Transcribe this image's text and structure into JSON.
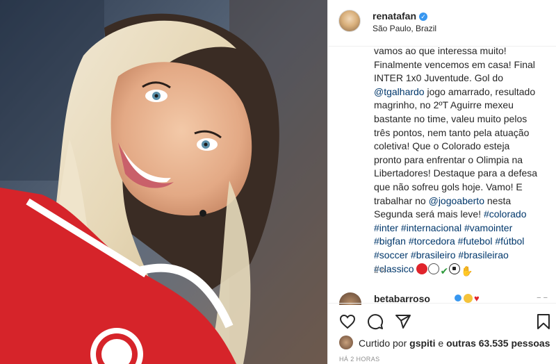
{
  "post": {
    "username": "renatafan",
    "location": "São Paulo, Brazil",
    "caption_lines": [
      [
        {
          "t": "vamos ao que interessa muito!"
        }
      ],
      [
        {
          "t": "Finalmente vencemos em casa! Final"
        }
      ],
      [
        {
          "t": "INTER 1x0 Juventude. Gol do"
        }
      ],
      [
        {
          "t": "@tgalhardo",
          "tag": true
        },
        {
          "t": " jogo amarrado, resultado"
        }
      ],
      [
        {
          "t": "magrinho, no 2ºT Aguirre mexeu"
        }
      ],
      [
        {
          "t": "bastante no time, valeu muito pelos"
        }
      ],
      [
        {
          "t": "três pontos, nem tanto pela atuação"
        }
      ],
      [
        {
          "t": "coletiva! Que o Colorado esteja"
        }
      ],
      [
        {
          "t": "pronto para enfrentar o Olimpia na"
        }
      ],
      [
        {
          "t": "Libertadores! Destaque para a defesa"
        }
      ],
      [
        {
          "t": "que não sofreu gols hoje. Vamo! E"
        }
      ],
      [
        {
          "t": "trabalhar no "
        },
        {
          "t": "@jogoaberto",
          "tag": true
        },
        {
          "t": " nesta"
        }
      ],
      [
        {
          "t": "Segunda será mais leve! "
        },
        {
          "t": "#colorado",
          "tag": true
        }
      ],
      [
        {
          "t": "#inter",
          "tag": true
        },
        {
          "t": " "
        },
        {
          "t": "#internacional",
          "tag": true
        },
        {
          "t": " "
        },
        {
          "t": "#vamointer",
          "tag": true
        }
      ],
      [
        {
          "t": "#bigfan",
          "tag": true
        },
        {
          "t": " "
        },
        {
          "t": "#torcedora",
          "tag": true
        },
        {
          "t": " "
        },
        {
          "t": "#futebol",
          "tag": true
        },
        {
          "t": " "
        },
        {
          "t": "#fútbol",
          "tag": true
        }
      ],
      [
        {
          "t": "#soccer",
          "tag": true
        },
        {
          "t": " "
        },
        {
          "t": "#brasileiro",
          "tag": true
        },
        {
          "t": " "
        },
        {
          "t": "#brasileirao",
          "tag": true
        }
      ],
      [
        {
          "t": "#classico",
          "tag": true
        }
      ]
    ],
    "caption_emojis": [
      "red-circle",
      "white-circle",
      "check",
      "soccer-ball",
      "pray"
    ],
    "time_ago": "2 h",
    "comment": {
      "username": "betabarroso",
      "right": "− −"
    },
    "likes": {
      "prefix": "Curtido por ",
      "user": "gspiti",
      "middle": " e ",
      "others": "outras 63.535 pessoas"
    },
    "post_time": "HÁ 2 HORAS"
  },
  "colors": {
    "link": "#00376b",
    "verified": "#3897f0",
    "jersey": "#d6242a"
  }
}
